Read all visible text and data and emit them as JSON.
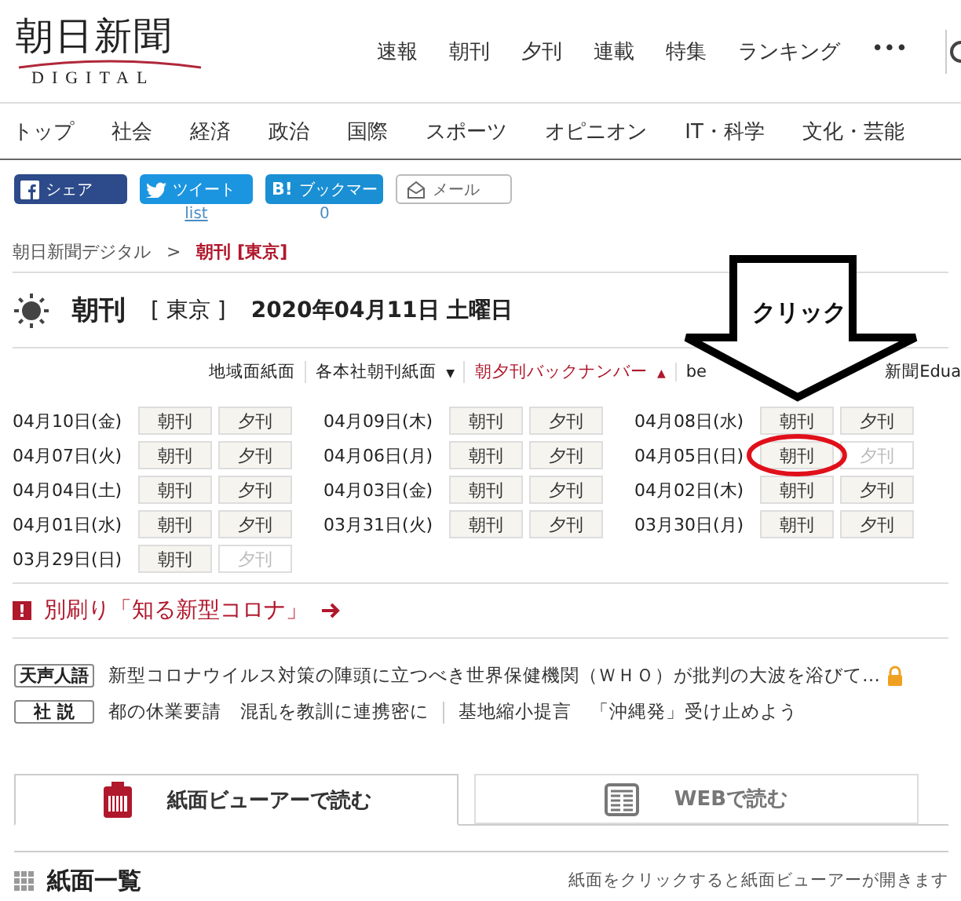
{
  "header": {
    "logo": {
      "title": "朝日新聞",
      "subtitle": "DIGITAL"
    },
    "top_nav": [
      "速報",
      "朝刊",
      "夕刊",
      "連載",
      "特集",
      "ランキング",
      "•••"
    ],
    "categories": [
      "トップ",
      "社会",
      "経済",
      "政治",
      "国際",
      "スポーツ",
      "オピニオン",
      "IT・科学",
      "文化・芸能"
    ]
  },
  "share_buttons": [
    {
      "kind": "facebook",
      "label": "シェア"
    },
    {
      "kind": "twitter",
      "label": "ツイート",
      "count": "list"
    },
    {
      "kind": "hatena",
      "label": "ブックマー",
      "icon_text": "B!",
      "count": "0"
    },
    {
      "kind": "mail",
      "label": "メール"
    }
  ],
  "breadcrumb": {
    "separator": ">",
    "items": [
      {
        "label": "朝日新聞デジタル",
        "current": false
      },
      {
        "label": "朝刊 [東京]",
        "current": true
      }
    ]
  },
  "edition": {
    "title": "朝刊",
    "region": "[ 東京 ]",
    "date": "2020年04月11日 土曜日"
  },
  "subnav": [
    {
      "label": "地域面紙面",
      "selected": false
    },
    {
      "label": "各本社朝刊紙面",
      "caret": "▼",
      "selected": false
    },
    {
      "label": "朝夕刊バックナンバー",
      "caret": "▲",
      "selected": true
    },
    {
      "label": "be",
      "selected": false
    },
    {
      "label": "新聞Edua",
      "selected": false
    }
  ],
  "backnumbers": [
    {
      "date": "04月10日(金)",
      "morning": {
        "label": "朝刊",
        "available": true,
        "circled": false
      },
      "evening": {
        "label": "夕刊",
        "available": true
      }
    },
    {
      "date": "04月09日(木)",
      "morning": {
        "label": "朝刊",
        "available": true,
        "circled": false
      },
      "evening": {
        "label": "夕刊",
        "available": true
      }
    },
    {
      "date": "04月08日(水)",
      "morning": {
        "label": "朝刊",
        "available": true,
        "circled": false
      },
      "evening": {
        "label": "夕刊",
        "available": true
      }
    },
    {
      "date": "04月07日(火)",
      "morning": {
        "label": "朝刊",
        "available": true,
        "circled": false
      },
      "evening": {
        "label": "夕刊",
        "available": true
      }
    },
    {
      "date": "04月06日(月)",
      "morning": {
        "label": "朝刊",
        "available": true,
        "circled": false
      },
      "evening": {
        "label": "夕刊",
        "available": true
      }
    },
    {
      "date": "04月05日(日)",
      "morning": {
        "label": "朝刊",
        "available": true,
        "circled": true
      },
      "evening": {
        "label": "夕刊",
        "available": false
      }
    },
    {
      "date": "04月04日(土)",
      "morning": {
        "label": "朝刊",
        "available": true,
        "circled": false
      },
      "evening": {
        "label": "夕刊",
        "available": true
      }
    },
    {
      "date": "04月03日(金)",
      "morning": {
        "label": "朝刊",
        "available": true,
        "circled": false
      },
      "evening": {
        "label": "夕刊",
        "available": true
      }
    },
    {
      "date": "04月02日(木)",
      "morning": {
        "label": "朝刊",
        "available": true,
        "circled": false
      },
      "evening": {
        "label": "夕刊",
        "available": true
      }
    },
    {
      "date": "04月01日(水)",
      "morning": {
        "label": "朝刊",
        "available": true,
        "circled": false
      },
      "evening": {
        "label": "夕刊",
        "available": true
      }
    },
    {
      "date": "03月31日(火)",
      "morning": {
        "label": "朝刊",
        "available": true,
        "circled": false
      },
      "evening": {
        "label": "夕刊",
        "available": true
      }
    },
    {
      "date": "03月30日(月)",
      "morning": {
        "label": "朝刊",
        "available": true,
        "circled": false
      },
      "evening": {
        "label": "夕刊",
        "available": true
      }
    },
    {
      "date": "03月29日(日)",
      "morning": {
        "label": "朝刊",
        "available": true,
        "circled": false
      },
      "evening": {
        "label": "夕刊",
        "available": false
      }
    }
  ],
  "special_link": {
    "badge": "!",
    "label": "別刷り「知る新型コロナ」"
  },
  "editorials": [
    {
      "tag": "天声人語",
      "items": [
        "新型コロナウイルス対策の陣頭に立つべき世界保健機関（ＷＨＯ）が批判の大波を浴びて…"
      ],
      "locked": true
    },
    {
      "tag": "社 説",
      "items": [
        "都の休業要請　混乱を教訓に連携密に",
        "基地縮小提言　「沖縄発」受け止めよう"
      ],
      "locked": false
    }
  ],
  "view_tabs": [
    {
      "kind": "viewer",
      "label": "紙面ビューアーで読む",
      "selected": true
    },
    {
      "kind": "web",
      "label": "WEBで読む",
      "selected": false
    }
  ],
  "page_list": {
    "title": "紙面一覧",
    "hint": "紙面をクリックすると紙面ビューアーが開きます"
  },
  "annotation": {
    "label": "クリック"
  }
}
